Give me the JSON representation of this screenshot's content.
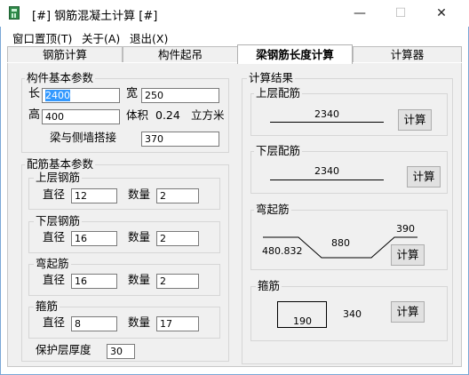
{
  "window": {
    "title": "[#] 钢筋混凝土计算 [#]",
    "controls": {
      "minimize": "—",
      "maximize": "☐",
      "close": "✕"
    }
  },
  "menu": [
    "窗口置顶(T)",
    "关于(A)",
    "退出(X)"
  ],
  "tabs": [
    "钢筋计算",
    "构件起吊",
    "梁钢筋长度计算",
    "计算器"
  ],
  "active_tab": 2,
  "basic": {
    "group": "构件基本参数",
    "length_label": "长",
    "length": "2400",
    "width_label": "宽",
    "width": "250",
    "height_label": "高",
    "height": "400",
    "volume_label": "体积",
    "volume": "0.24",
    "volume_unit": "立方米",
    "overlap_label": "梁与侧墙搭接",
    "overlap": "370"
  },
  "rebar": {
    "group": "配筋基本参数",
    "upper": {
      "title": "上层钢筋",
      "dia_label": "直径",
      "dia": "12",
      "qty_label": "数量",
      "qty": "2"
    },
    "lower": {
      "title": "下层钢筋",
      "dia_label": "直径",
      "dia": "16",
      "qty_label": "数量",
      "qty": "2"
    },
    "bent": {
      "title": "弯起筋",
      "dia_label": "直径",
      "dia": "16",
      "qty_label": "数量",
      "qty": "2"
    },
    "stirrup": {
      "title": "箍筋",
      "dia_label": "直径",
      "dia": "8",
      "qty_label": "数量",
      "qty": "17"
    },
    "cover_label": "保护层厚度",
    "cover": "30"
  },
  "results": {
    "group": "计算结果",
    "upper": {
      "title": "上层配筋",
      "value": "2340",
      "button": "计算"
    },
    "lower": {
      "title": "下层配筋",
      "value": "2340",
      "button": "计算"
    },
    "bent": {
      "title": "弯起筋",
      "left": "480.832",
      "mid": "880",
      "right": "390",
      "button": "计算"
    },
    "stirrup": {
      "title": "箍筋",
      "box": "190",
      "value": "340",
      "button": "计算"
    }
  }
}
